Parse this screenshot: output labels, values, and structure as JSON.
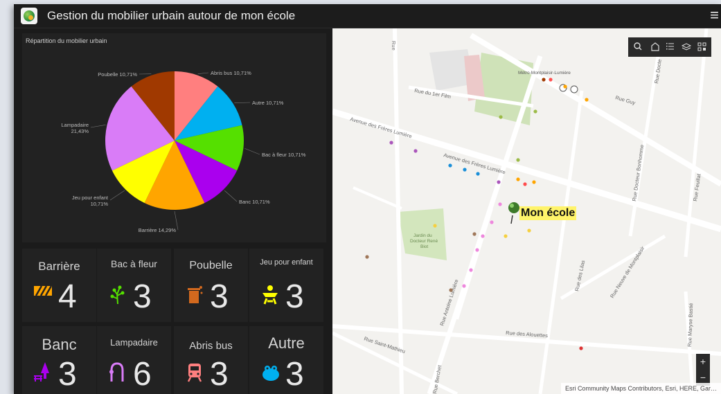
{
  "app": {
    "title": "Gestion du mobilier urbain autour de mon école",
    "menu_icon": "hamburger-menu-icon"
  },
  "chart": {
    "title": "Répartition du mobilier urbain"
  },
  "chart_data": {
    "type": "pie",
    "title": "Répartition du mobilier urbain",
    "slices": [
      {
        "label": "Abris bus 10,71%",
        "name": "Abris bus",
        "value": 10.71,
        "color": "#ff7f7f"
      },
      {
        "label": "Autre 10,71%",
        "name": "Autre",
        "value": 10.71,
        "color": "#00b0f0"
      },
      {
        "label": "Bac à fleur 10,71%",
        "name": "Bac à fleur",
        "value": 10.71,
        "color": "#55e000"
      },
      {
        "label": "Banc 10,71%",
        "name": "Banc",
        "value": 10.71,
        "color": "#aa00ee"
      },
      {
        "label": "Barrière 14,29%",
        "name": "Barrière",
        "value": 14.29,
        "color": "#ffa500"
      },
      {
        "label": "Jeu pour enfant 10,71%",
        "name": "Jeu pour enfant",
        "value": 10.71,
        "color": "#ffff00"
      },
      {
        "label": "Lampadaire 21,43%",
        "name": "Lampadaire",
        "value": 21.43,
        "color": "#d97cf7"
      },
      {
        "label": "Poubelle 10,71%",
        "name": "Poubelle",
        "value": 10.71,
        "color": "#a03900"
      }
    ]
  },
  "counters": [
    {
      "label": "Barrière",
      "value": "4",
      "icon": "barrier-icon",
      "color": "#ffa500"
    },
    {
      "label": "Bac à fleur",
      "value": "3",
      "icon": "flower-icon",
      "color": "#55e000"
    },
    {
      "label": "Poubelle",
      "value": "3",
      "icon": "trash-icon",
      "color": "#d2691e"
    },
    {
      "label": "Jeu pour enfant",
      "value": "3",
      "icon": "playground-icon",
      "color": "#ffff00"
    },
    {
      "label": "Banc",
      "value": "3",
      "icon": "bench-icon",
      "color": "#aa00ee"
    },
    {
      "label": "Lampadaire",
      "value": "6",
      "icon": "streetlight-icon",
      "color": "#d97cf7"
    },
    {
      "label": "Abris bus",
      "value": "3",
      "icon": "bus-icon",
      "color": "#ff7f7f"
    },
    {
      "label": "Autre",
      "value": "3",
      "icon": "frog-icon",
      "color": "#00b0f0"
    }
  ],
  "map": {
    "school_label": "Mon école",
    "streets": [
      "Rue",
      "Rue du 1er Film",
      "Avenue des Frères Lumière",
      "Avenue des Frères Lumière",
      "Rue Guy",
      "Rue Docteur Bonhomme",
      "Rue Feuillat",
      "Rue Docte",
      "Rue des Lilas",
      "Rue Neuve de Montplaisir",
      "Rue des Alouettes",
      "Rue Saint-Mathieu",
      "Rue Antoine Lumière",
      "Rue Maryse Bastié",
      "Rue Berchet",
      "Jardin du Docteur René Biot",
      "Métro-Montplaisir-Lumière"
    ],
    "tools": [
      "search-icon",
      "home-icon",
      "legend-icon",
      "layers-icon",
      "qr-code-icon"
    ],
    "zoom_in": "+",
    "zoom_out": "−",
    "attribution": "Esri Community Maps Contributors, Esri, HERE, Gar…"
  }
}
